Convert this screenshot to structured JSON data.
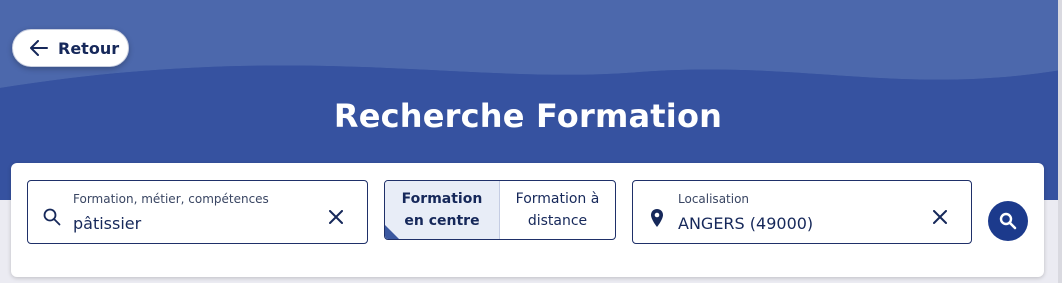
{
  "header": {
    "back_label": "Retour",
    "title": "Recherche Formation"
  },
  "search": {
    "label": "Formation, métier, compétences",
    "value": "pâtissier"
  },
  "mode_toggle": {
    "options": [
      {
        "line1": "Formation",
        "line2": "en centre",
        "selected": true
      },
      {
        "line1": "Formation à",
        "line2": "distance",
        "selected": false
      }
    ]
  },
  "location": {
    "label": "Localisation",
    "value": "ANGERS (49000)"
  },
  "icons": {
    "back": "arrow-left-icon",
    "search": "search-icon",
    "clear": "close-icon",
    "location": "map-pin-icon",
    "submit": "search-icon"
  },
  "colors": {
    "hero": "#3b58a0",
    "primary": "#1c3a8c",
    "text": "#16285a"
  }
}
